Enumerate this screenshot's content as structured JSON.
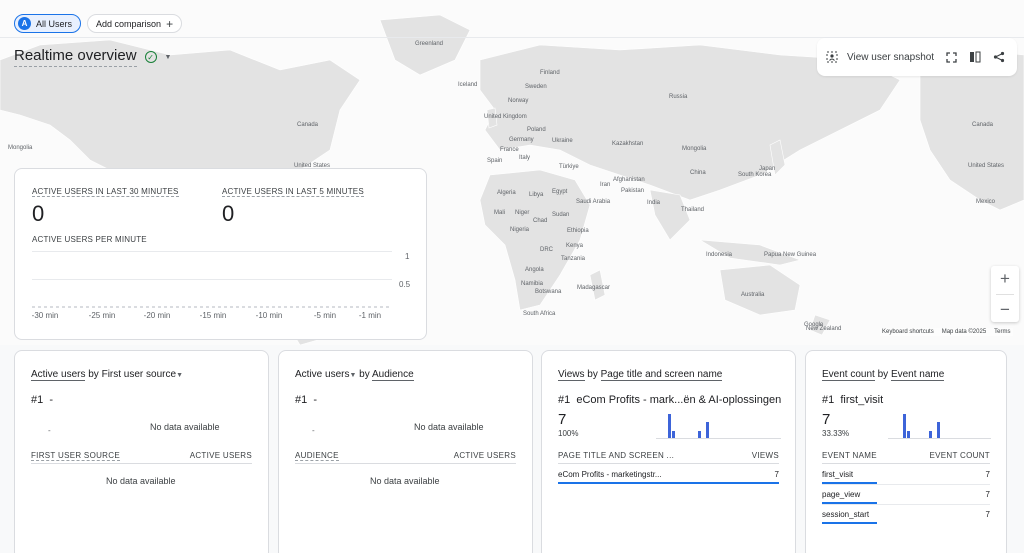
{
  "comparisons": {
    "segment_badge": "A",
    "segment": "All Users",
    "add": "Add comparison"
  },
  "page_title": "Realtime overview",
  "snapshot": {
    "label": "View user snapshot"
  },
  "map": {
    "labels": [
      "Greenland",
      "Iceland",
      "Finland",
      "Sweden",
      "Norway",
      "Russia",
      "United Kingdom",
      "Poland",
      "Germany",
      "Ukraine",
      "France",
      "Italy",
      "Kazakhstan",
      "Spain",
      "Türkiye",
      "Mongolia",
      "Japan",
      "South Korea",
      "China",
      "Iran",
      "Afghanistan",
      "Pakistan",
      "Algeria",
      "Libya",
      "Egypt",
      "Saudi Arabia",
      "India",
      "Thailand",
      "Mali",
      "Niger",
      "Chad",
      "Sudan",
      "Nigeria",
      "Ethiopia",
      "DRC",
      "Kenya",
      "Tanzania",
      "Angola",
      "Namibia",
      "Madagascar",
      "Botswana",
      "South Africa",
      "Indonesia",
      "Papua New Guinea",
      "Australia",
      "New Zealand",
      "Canada",
      "United States",
      "Mexico",
      "Mongolia"
    ],
    "keyboard": "Keyboard shortcuts",
    "mapdata": "Map data ©2025",
    "terms": "Terms",
    "google": "Google"
  },
  "realtime": {
    "m30_label": "ACTIVE USERS IN LAST 30 MINUTES",
    "m30_value": "0",
    "m5_label": "ACTIVE USERS IN LAST 5 MINUTES",
    "m5_value": "0",
    "per_minute_label": "ACTIVE USERS PER MINUTE",
    "y_ticks": [
      "1",
      "0.5"
    ],
    "x_ticks": [
      "-30 min",
      "-25 min",
      "-20 min",
      "-15 min",
      "-10 min",
      "-5 min",
      "-1 min"
    ]
  },
  "cards": {
    "source": {
      "title_a": "Active users",
      "title_by": " by ",
      "title_b": "First user source",
      "rank": "#1",
      "rank_value": "-",
      "no_data_top": "No data available",
      "dash": "-",
      "col1": "FIRST USER SOURCE",
      "col2": "ACTIVE USERS",
      "no_data_bottom": "No data available"
    },
    "audience": {
      "title_a": "Active users",
      "title_by": " by ",
      "title_b": "Audience",
      "rank": "#1",
      "rank_value": "-",
      "no_data_top": "No data available",
      "dash": "-",
      "col1": "AUDIENCE",
      "col2": "ACTIVE USERS",
      "no_data_bottom": "No data available"
    },
    "views": {
      "title_a": "Views",
      "title_by": " by ",
      "title_b": "Page title and screen name",
      "rank": "#1",
      "rank_value": "eCom Profits - mark...ën & AI-oplossingen",
      "big": "7",
      "pct": "100%",
      "col1": "PAGE TITLE AND SCREEN ...",
      "col2": "VIEWS",
      "rows": [
        {
          "name": "eCom Profits - marketingstr...",
          "value": "7",
          "share": 1.0
        }
      ]
    },
    "events": {
      "title_a": "Event count",
      "title_by": " by ",
      "title_b": "Event name",
      "rank": "#1",
      "rank_value": "first_visit",
      "big": "7",
      "pct": "33.33%",
      "col1": "EVENT NAME",
      "col2": "EVENT COUNT",
      "rows": [
        {
          "name": "first_visit",
          "value": "7",
          "share": 0.33
        },
        {
          "name": "page_view",
          "value": "7",
          "share": 0.33
        },
        {
          "name": "session_start",
          "value": "7",
          "share": 0.33
        }
      ]
    }
  },
  "colors": {
    "accent": "#1a73e8",
    "bar": "#3d64d9",
    "ok": "#188038"
  }
}
